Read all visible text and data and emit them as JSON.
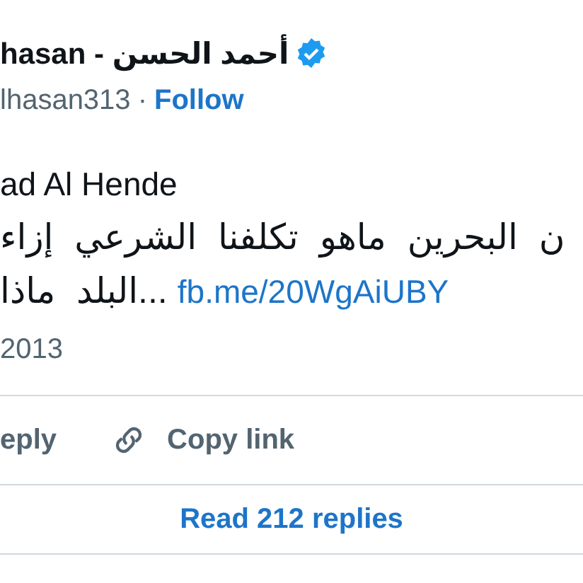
{
  "author": {
    "name": "hasan - أحمد الحسن",
    "verified": true,
    "handle": "lhasan313",
    "separator": "·",
    "follow": "Follow"
  },
  "tweet": {
    "lines": [
      {
        "kind": "text",
        "text": "ad Al Hende"
      },
      {
        "kind": "arabic",
        "text": "ن البحرين ماهو تكلفنا الشرعي إزاء"
      },
      {
        "kind": "arabic_link",
        "text": "...البلد ماذا",
        "link": "fb.me/20WgAiUBY"
      }
    ],
    "date": "2013"
  },
  "actions": [
    {
      "kind": "reply",
      "label": "eply"
    },
    {
      "kind": "copy",
      "label": "Copy link"
    }
  ],
  "read_replies": "Read 212 replies"
}
